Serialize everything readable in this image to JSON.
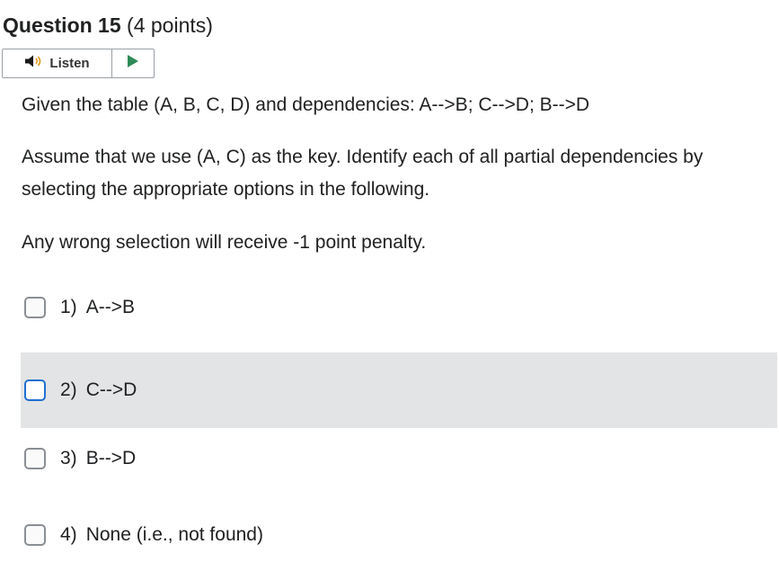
{
  "question": {
    "title": "Question 15",
    "points": "(4 points)"
  },
  "listen": {
    "label": "Listen",
    "speaker_icon": "speaker-icon",
    "play_icon": "play-icon"
  },
  "stem": {
    "line1": "Given the table (A, B, C, D) and dependencies: A-->B;  C-->D; B-->D",
    "line2": "Assume that we use (A, C) as the key. Identify each of all partial dependencies by selecting the appropriate options in the following.",
    "line3": "Any wrong selection will receive -1 point penalty."
  },
  "options": [
    {
      "number": "1)",
      "text": "A-->B",
      "checked": false
    },
    {
      "number": "2)",
      "text": "C-->D",
      "checked": false
    },
    {
      "number": "3)",
      "text": "B-->D",
      "checked": false
    },
    {
      "number": "4)",
      "text": "None (i.e., not found)",
      "checked": false
    }
  ],
  "colors": {
    "hover_bg": "#e3e4e5",
    "focus_border": "#1f6fd1",
    "play_green": "#2e8b57",
    "text": "#202122"
  }
}
